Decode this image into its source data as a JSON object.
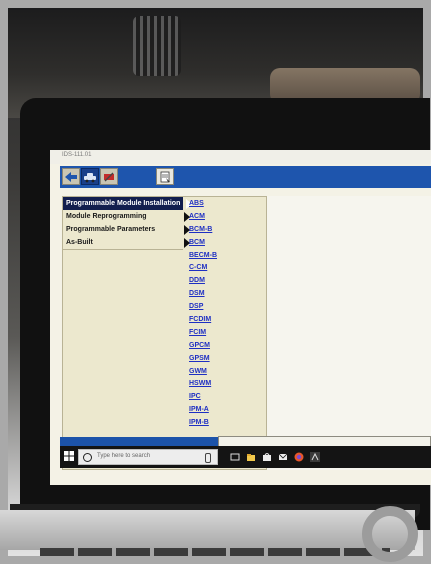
{
  "app": {
    "title": "IDS-111.01"
  },
  "toolbar": {
    "buttons": [
      {
        "icon": "back-arrow-icon"
      },
      {
        "icon": "vehicle-icon"
      },
      {
        "icon": "tools-icon"
      },
      {
        "icon": "reports-icon"
      }
    ]
  },
  "menu": {
    "items": [
      {
        "label": "Programmable Module Installation",
        "selected": true
      },
      {
        "label": "Module Reprogramming",
        "selected": false
      },
      {
        "label": "Programmable Parameters",
        "selected": false
      },
      {
        "label": "As-Built",
        "selected": false
      }
    ]
  },
  "modules": [
    "ABS",
    "ACM",
    "BCM-B",
    "BCM",
    "BECM-B",
    "C-CM",
    "DDM",
    "DSM",
    "DSP",
    "FCDIM",
    "FCIM",
    "GPCM",
    "GPSM",
    "GWM",
    "HSWM",
    "IPC",
    "IPM-A",
    "IPM-B"
  ],
  "taskbar": {
    "search_placeholder": "Type here to search"
  },
  "colors": {
    "toolbar_blue": "#1e55ad",
    "menu_bg": "#ece8ce",
    "selected_bg": "#121e4e",
    "link_blue": "#1e2fc3"
  }
}
